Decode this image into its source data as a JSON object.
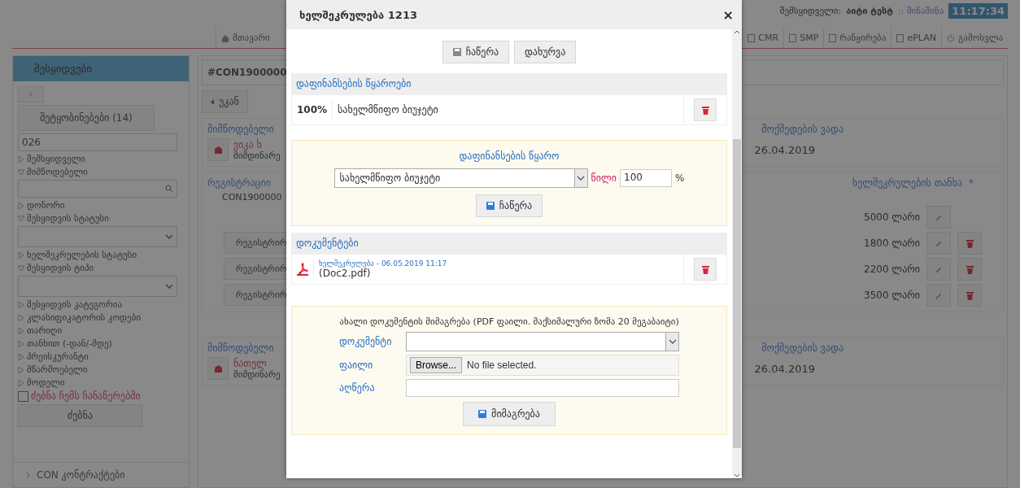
{
  "header": {
    "user_label": "შემსყიდველი:",
    "user_name": "აიტი ტესტ",
    "org": ":: შინაშინა",
    "time": "11:17:34",
    "nav": [
      {
        "label": "მთავარი"
      },
      {
        "label": "CMR"
      },
      {
        "label": "SMP"
      },
      {
        "label": "რანჟირება"
      },
      {
        "label": "ePLAN"
      },
      {
        "label": "გამოსვლა"
      }
    ]
  },
  "sidebar": {
    "title": "შესყიდვები",
    "messages": "შეტყობინებები (14)",
    "search_value": "026",
    "filters": [
      {
        "label": "შემსყიდველი",
        "expanded": false
      },
      {
        "label": "მიმწოდებელი",
        "expanded": true,
        "kind": "search"
      },
      {
        "label": "დონორი",
        "expanded": false
      },
      {
        "label": "შესყიდვის სტატუსი",
        "expanded": true,
        "kind": "select"
      },
      {
        "label": "ხელშეკრულების სტატუსი",
        "expanded": false
      },
      {
        "label": "შესყიდვის ტიპი",
        "expanded": true,
        "kind": "select"
      },
      {
        "label": "შესყიდვის კატეგორია",
        "expanded": false
      },
      {
        "label": "კლასიფიკატორის კოდები",
        "expanded": false
      },
      {
        "label": "თარიღი",
        "expanded": false
      },
      {
        "label": "თანხით (-დან/-მდე)",
        "expanded": false
      },
      {
        "label": "პრეისკურანტი",
        "expanded": false
      },
      {
        "label": "მწარმოებელი",
        "expanded": false
      },
      {
        "label": "მოდელი",
        "expanded": false
      }
    ],
    "mine_checkbox": {
      "label": "ძებნა ჩემს ჩანაწერებში",
      "checked": false
    },
    "search_button": "ძებნა",
    "next_section": "CON კონტრაქტები"
  },
  "main": {
    "title": "#CON1900000",
    "back": "უკან",
    "suppliers": [
      {
        "label": "მიმწოდებელი",
        "name": "ვიკა ხ",
        "status": "მიმდინარე",
        "term_label": "მოქმედების ვადა",
        "term": "26.04.2019"
      },
      {
        "label": "მიმწოდებელი",
        "name": "ნათელ",
        "status": "მიმდინარე",
        "term_label": "მოქმედების ვადა",
        "term": "26.04.2019"
      }
    ],
    "registration": {
      "label": "რეგისტრაციი",
      "amount_label": "ხელშეკრულების თანხა",
      "required_mark": "*",
      "number": "CON1900000",
      "rows": [
        {
          "label": "",
          "amount": "5000 ლარი",
          "deletable": false
        },
        {
          "label": "რეგისტრირ",
          "amount": "1800 ლარი",
          "deletable": true
        },
        {
          "label": "რეგისტრირ",
          "amount": "2200 ლარი",
          "deletable": true
        },
        {
          "label": "რეგისტრირ",
          "amount": "3500 ლარი",
          "deletable": true
        }
      ]
    }
  },
  "modal": {
    "title": "ხელშეკრულება 1213",
    "close": "×",
    "save": "ჩაწერა",
    "cancel": "დახურვა",
    "funding": {
      "header": "დაფინანსების წყაროები",
      "rows": [
        {
          "share": "100%",
          "source": "სახელმწიფო ბიუჯეტი"
        }
      ],
      "form": {
        "title": "დაფინანსების წყარო",
        "source": "სახელმწიფო ბიუჯეტი",
        "share_label": "წილი",
        "share": "100",
        "percent": "%",
        "save": "ჩაწერა"
      }
    },
    "documents": {
      "header": "დოკუმენტები",
      "rows": [
        {
          "caption": "ხელშეკრულება - 06.05.2019 11:17",
          "file": "(Doc2.pdf)"
        }
      ],
      "form": {
        "title": "ახალი დოკუმენტის მიმაგრება (PDF ფაილი. მაქსიმალური ზომა 20 მეგაბაიტი)",
        "doc_label": "დოკუმენტი",
        "file_label": "ფაილი",
        "browse": "Browse...",
        "no_file": "No file selected.",
        "desc_label": "აღწერა",
        "attach": "მიმაგრება"
      }
    }
  }
}
